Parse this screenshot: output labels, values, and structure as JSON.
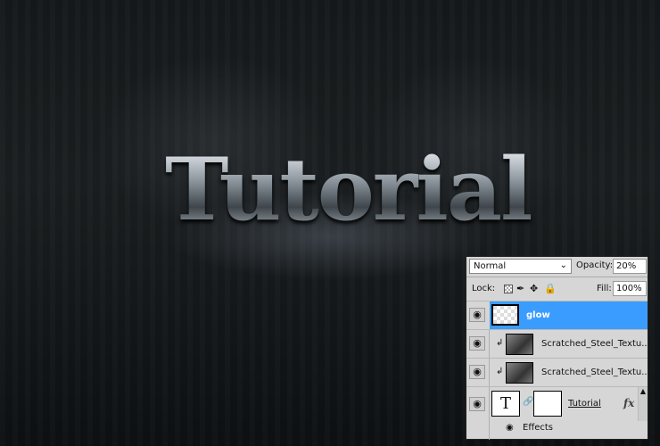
{
  "artwork": {
    "title": "Tutorial"
  },
  "layers_panel": {
    "blend_mode": "Normal",
    "opacity_label": "Opacity:",
    "opacity": "20%",
    "lock_label": "Lock:",
    "fill_label": "Fill:",
    "fill": "100%",
    "layers": [
      {
        "name": "glow",
        "selected": true
      },
      {
        "name": "Scratched_Steel_Textu...",
        "clipped": true
      },
      {
        "name": "Scratched_Steel_Textu...",
        "clipped": true
      },
      {
        "name": "Tutorial",
        "type": "text",
        "thumb": "T",
        "fx": "fx"
      }
    ],
    "effects_label": "Effects",
    "selected_color": "#3b9cff"
  }
}
